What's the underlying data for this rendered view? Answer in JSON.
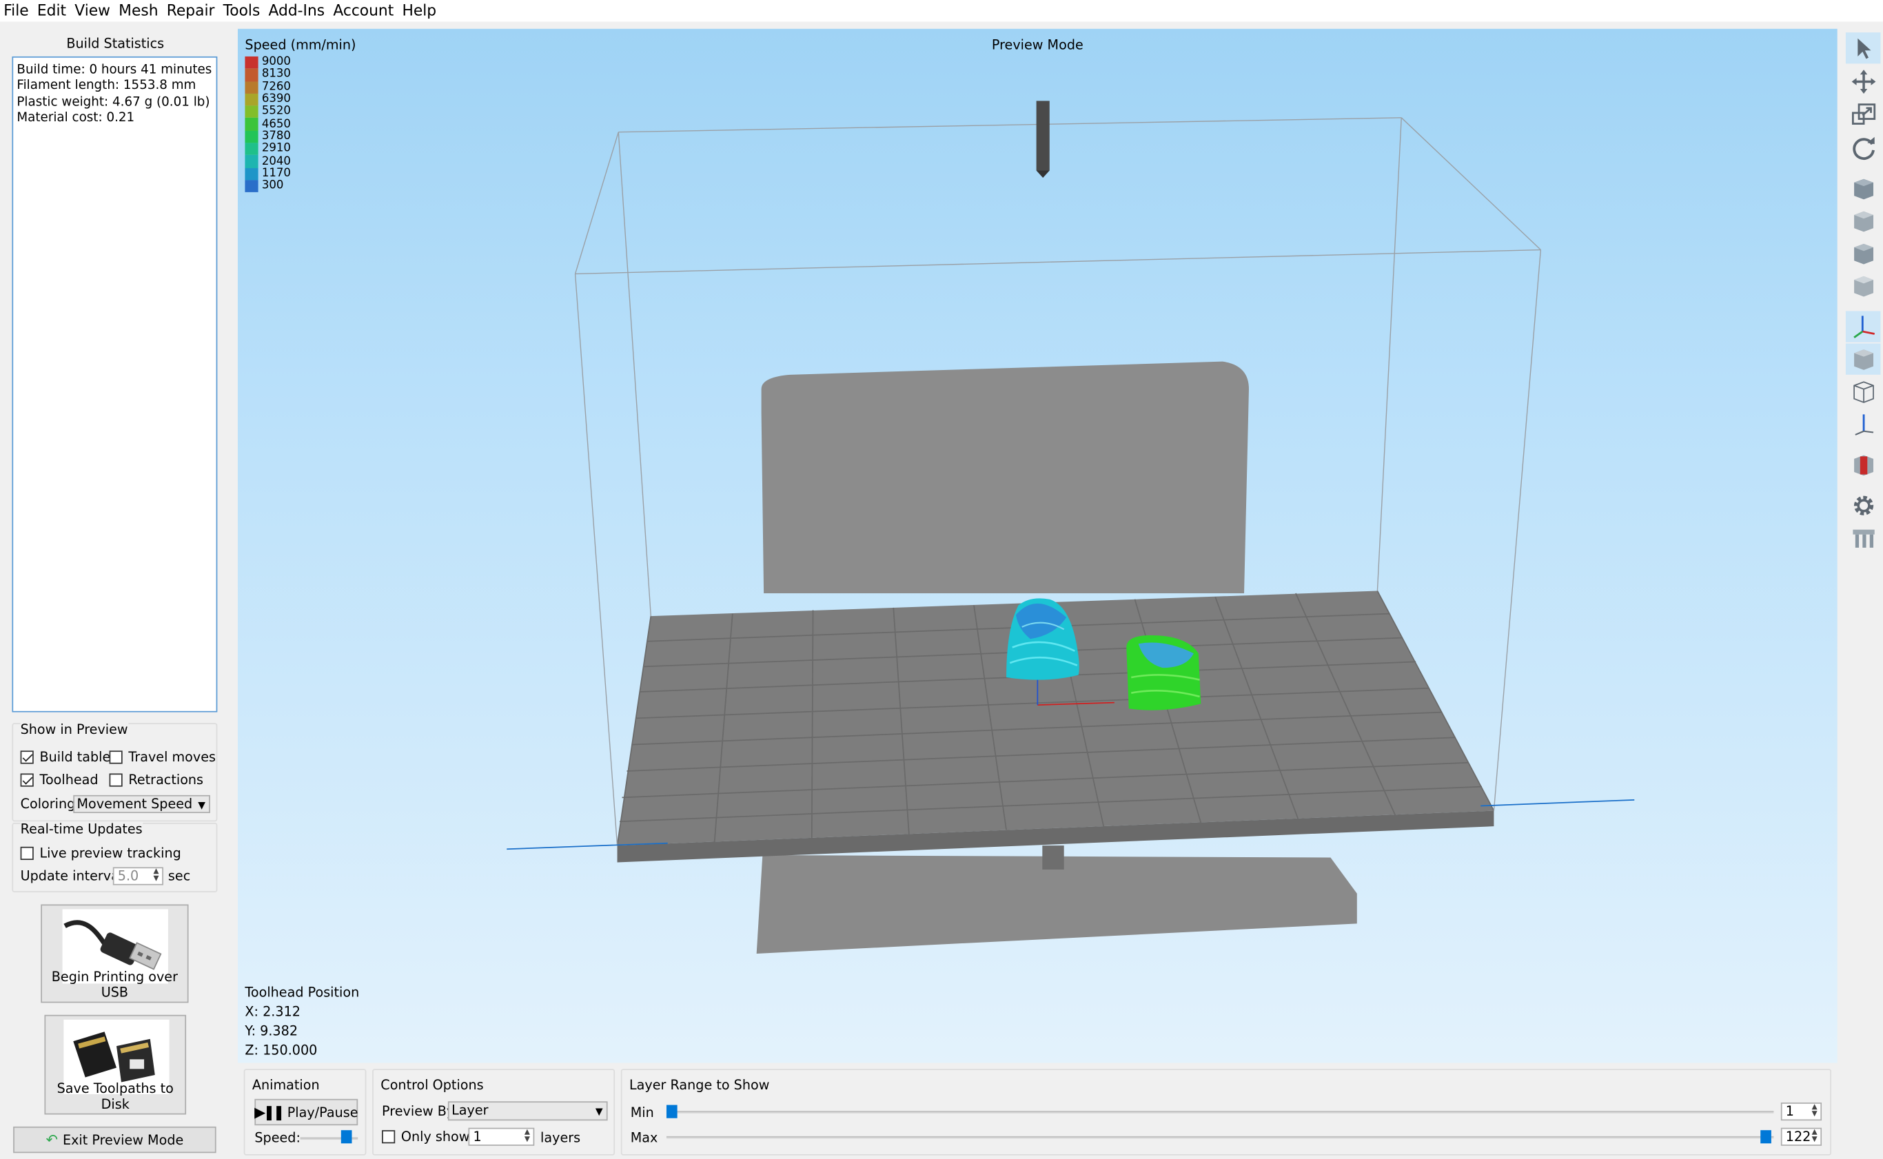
{
  "menu": [
    "File",
    "Edit",
    "View",
    "Mesh",
    "Repair",
    "Tools",
    "Add-Ins",
    "Account",
    "Help"
  ],
  "build_stats": {
    "title": "Build Statistics",
    "lines": [
      "Build time: 0 hours 41 minutes",
      "Filament length: 1553.8 mm",
      "Plastic weight: 4.67 g (0.01 lb)",
      "Material cost: 0.21"
    ]
  },
  "show_in_preview": {
    "title": "Show in Preview",
    "build_table": {
      "label": "Build table",
      "checked": true
    },
    "travel_moves": {
      "label": "Travel moves",
      "checked": false
    },
    "toolhead": {
      "label": "Toolhead",
      "checked": true
    },
    "retractions": {
      "label": "Retractions",
      "checked": false
    },
    "coloring_label": "Coloring",
    "coloring_value": "Movement Speed"
  },
  "realtime": {
    "title": "Real-time Updates",
    "live_tracking": {
      "label": "Live preview tracking",
      "checked": false
    },
    "interval_label": "Update interval",
    "interval_value": "5.0",
    "interval_unit": "sec"
  },
  "buttons": {
    "usb": "Begin Printing over USB",
    "sd": "Save Toolpaths to Disk",
    "exit": "Exit Preview Mode"
  },
  "viewport": {
    "mode_title": "Preview Mode",
    "legend_title": "Speed (mm/min)",
    "legend": [
      {
        "value": "9000",
        "color": "#c8322d"
      },
      {
        "value": "8130",
        "color": "#c25a2e"
      },
      {
        "value": "7260",
        "color": "#b87a2c"
      },
      {
        "value": "6390",
        "color": "#a9a52a"
      },
      {
        "value": "5520",
        "color": "#82be2a"
      },
      {
        "value": "4650",
        "color": "#3cc43a"
      },
      {
        "value": "3780",
        "color": "#22c457"
      },
      {
        "value": "2910",
        "color": "#1fc08a"
      },
      {
        "value": "2040",
        "color": "#1eb5b0"
      },
      {
        "value": "1170",
        "color": "#1e95c8"
      },
      {
        "value": "300",
        "color": "#2a6ec9"
      }
    ],
    "toolhead_title": "Toolhead Position",
    "x": "X: 2.312",
    "y": "Y: 9.382",
    "z": "Z: 150.000"
  },
  "right_toolbar": [
    "select-arrow-icon",
    "move-icon",
    "scale-icon",
    "rotate-icon",
    "view-cube-front-icon",
    "view-cube-top-icon",
    "view-cube-side-icon",
    "view-cube-iso-icon",
    "axes-icon",
    "solid-view-icon",
    "wireframe-view-icon",
    "axis-z-icon",
    "section-view-icon",
    "gear-icon",
    "supports-icon"
  ],
  "animation": {
    "title": "Animation",
    "play_label": "Play/Pause",
    "speed_label": "Speed:"
  },
  "control_options": {
    "title": "Control Options",
    "preview_by_label": "Preview By",
    "preview_by_value": "Layer",
    "only_show_label": "Only show",
    "only_show_value": "1",
    "only_show_checked": false,
    "layers_label": "layers"
  },
  "layer_range": {
    "title": "Layer Range to Show",
    "min_label": "Min",
    "max_label": "Max",
    "min_value": "1",
    "max_value": "122"
  },
  "colors": {
    "accent": "#0078d7",
    "viewport_top": "#9fd3f5",
    "model_cyan": "#1fc8d8",
    "model_green": "#2ed12a"
  }
}
